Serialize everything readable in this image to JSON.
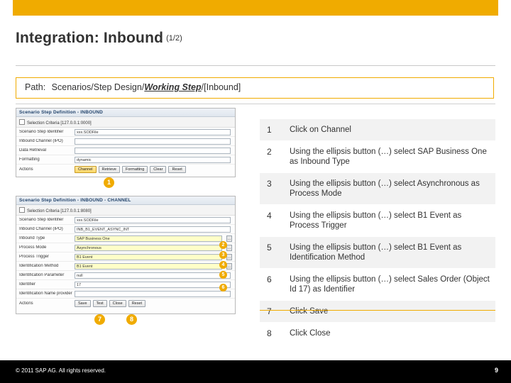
{
  "slide": {
    "title": "Integration: Inbound",
    "title_suffix": "(1/2)",
    "path_label": "Path:",
    "path_prefix": "Scenarios/Step Design/",
    "path_bold": "Working Step",
    "path_suffix": "/[Inbound]"
  },
  "steps": [
    {
      "n": "1",
      "text": "Click on Channel"
    },
    {
      "n": "2",
      "text": "Using the ellipsis button (…) select SAP Business One as Inbound Type"
    },
    {
      "n": "3",
      "text": "Using the ellipsis button (…) select Asynchronous as Process Mode"
    },
    {
      "n": "4",
      "text": "Using the ellipsis button (…) select B1 Event as Process Trigger"
    },
    {
      "n": "5",
      "text": "Using the ellipsis button (…) select B1 Event as Identification Method"
    },
    {
      "n": "6",
      "text": "Using the ellipsis button (…) select Sales Order (Object  Id 17) as Identifier"
    },
    {
      "n": "7",
      "text": "Click Save"
    },
    {
      "n": "8",
      "text": "Click Close"
    }
  ],
  "screenshot_top": {
    "window_title": "Scenario Step Definition - INBOUND",
    "selection_criteria": "Selection Criteria  [127.0.0.1:0000]",
    "rows": [
      {
        "label": "Scenario Step Identifier",
        "value": "xxx.SODFile"
      },
      {
        "label": "Inbound Channel (IPO)",
        "value": ""
      },
      {
        "label": "Data Retrieval",
        "value": ""
      },
      {
        "label": "Formatting",
        "value": "dynamic"
      },
      {
        "label": "Actions",
        "value": ""
      }
    ],
    "buttons": [
      "Channel",
      "Retrieve",
      "Formatting",
      "Clear",
      "Reset"
    ],
    "callout": "1"
  },
  "screenshot_bottom": {
    "window_title": "Scenario Step Definition - INBOUND - CHANNEL",
    "selection_criteria": "Selection Criteria  [127.0.0.1:8080]",
    "rows": [
      {
        "label": "Scenario Step Identifier",
        "value": "xxx.SODFile"
      },
      {
        "label": "Inbound Channel (IPO)",
        "value": "INB_B1_EVENT_ASYNC_INT"
      },
      {
        "label": "Inbound Type",
        "value": "SAP Business One",
        "callout": "2"
      },
      {
        "label": "Process Mode",
        "value": "Asynchronous",
        "callout": "3"
      },
      {
        "label": "Process Trigger",
        "value": "B1 Event",
        "callout": "4"
      },
      {
        "label": "Identification Method",
        "value": "B1 Event",
        "callout": "5"
      },
      {
        "label": "Identification Parameter",
        "value": "null"
      },
      {
        "label": "Identifier",
        "value": "17",
        "callout": "6"
      },
      {
        "label": "Identification Name provider",
        "value": ""
      },
      {
        "label": "Actions",
        "value": ""
      }
    ],
    "buttons": [
      "Save",
      "Test",
      "Close",
      "Reset"
    ],
    "callout_save": "7",
    "callout_close": "8"
  },
  "footer": {
    "copyright": "© 2011 SAP AG. All rights reserved.",
    "page": "9"
  },
  "colors": {
    "accent": "#f0ab00",
    "row_alt": "#f2f2f2",
    "text": "#333333"
  }
}
